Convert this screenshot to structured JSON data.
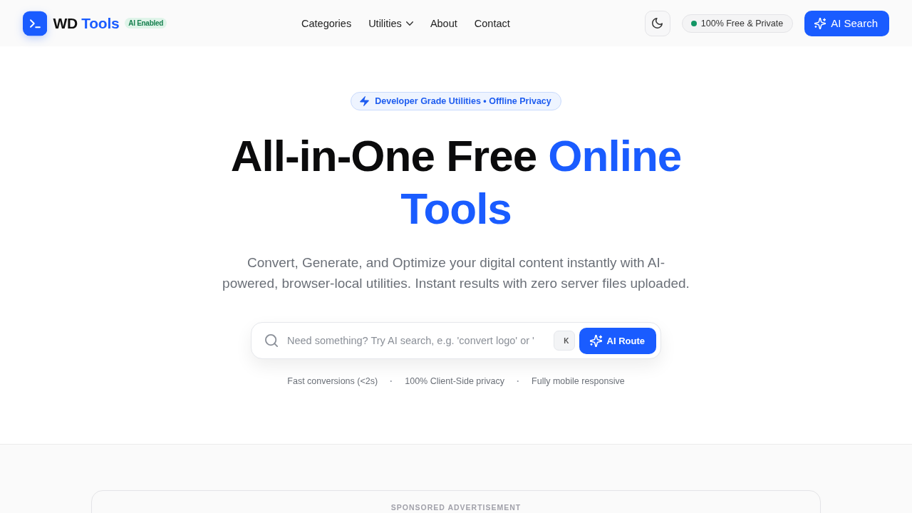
{
  "header": {
    "logo": {
      "name": "WD",
      "highlight": "Tools",
      "badge": "AI Enabled"
    },
    "nav": [
      {
        "label": "Categories",
        "kind": "link"
      },
      {
        "label": "Utilities",
        "kind": "dropdown"
      },
      {
        "label": "About",
        "kind": "link"
      },
      {
        "label": "Contact",
        "kind": "link"
      }
    ],
    "status_pill": "100% Free & Private",
    "search_button": "AI Search"
  },
  "hero": {
    "tag": "Developer Grade Utilities • Offline Privacy",
    "title": "All-in-One Free",
    "title_highlight": "Online Tools",
    "subtitle": "Convert, Generate, and Optimize your digital content instantly with AI-powered, browser-local utilities. Instant results with zero server files uploaded.",
    "search": {
      "placeholder": "Need something? Try AI search, e.g. 'convert logo' or '",
      "shortcut": "K",
      "button": "AI Route"
    },
    "features": [
      {
        "kind": "feature",
        "text": "Fast conversions (<2s)"
      },
      {
        "kind": "separator",
        "text": "·"
      },
      {
        "kind": "feature",
        "text": "100% Client-Side privacy"
      },
      {
        "kind": "separator",
        "text": "·"
      },
      {
        "kind": "feature",
        "text": "Fully mobile responsive"
      }
    ]
  },
  "ad": {
    "label": "SPONSORED ADVERTISEMENT"
  }
}
